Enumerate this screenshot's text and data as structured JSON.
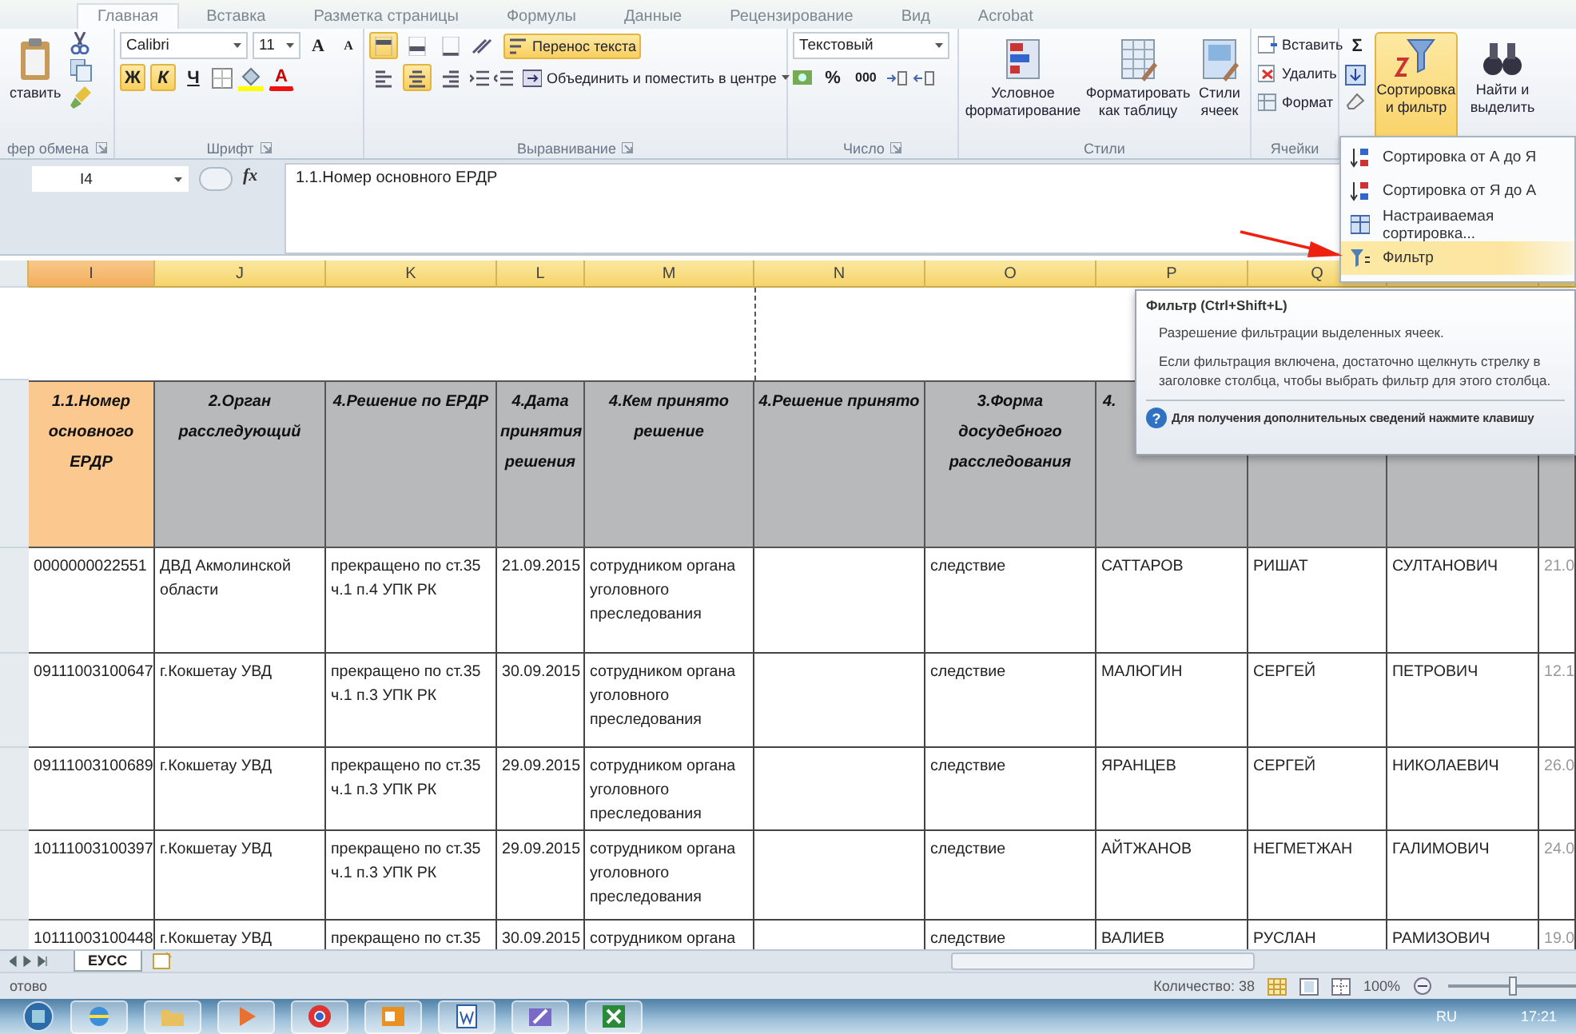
{
  "ribbon_tabs": [
    {
      "label": "Главная",
      "selected": true
    },
    {
      "label": "Вставка",
      "selected": false
    },
    {
      "label": "Разметка страницы",
      "selected": false
    },
    {
      "label": "Формулы",
      "selected": false
    },
    {
      "label": "Данные",
      "selected": false
    },
    {
      "label": "Рецензирование",
      "selected": false
    },
    {
      "label": "Вид",
      "selected": false
    },
    {
      "label": "Acrobat",
      "selected": false
    }
  ],
  "ribbon": {
    "clipboard": {
      "paste": "ставить",
      "label": "фер обмена"
    },
    "font": {
      "name": "Calibri",
      "size": "11",
      "grow": "A",
      "shrink": "A",
      "styles": [
        {
          "label": "Ж",
          "selected": true
        },
        {
          "label": "К",
          "selected": true
        },
        {
          "label": "Ч",
          "selected": false
        }
      ],
      "color_letter": "А",
      "label": "Шрифт"
    },
    "alignment": {
      "vertical_align": [
        {
          "selected": true
        },
        {
          "selected": false
        },
        {
          "selected": false
        }
      ],
      "horizontal_align": [
        {
          "selected": false
        },
        {
          "selected": true
        },
        {
          "selected": false
        }
      ],
      "wrap": {
        "label": "Перенос текста",
        "selected": true
      },
      "merge": "Объединить и поместить в центре",
      "label": "Выравнивание"
    },
    "number": {
      "format": "Текстовый",
      "percent": "%",
      "thousands": "000",
      "label": "Число"
    },
    "styles": {
      "buttons": [
        "Условное форматирование",
        "Форматировать как таблицу",
        "Стили ячеек"
      ],
      "label": "Стили"
    },
    "cells": {
      "buttons": [
        "Вставить",
        "Удалить",
        "Формат"
      ],
      "label": "Ячейки"
    },
    "editing": {
      "sum": "Σ",
      "buttons": [
        {
          "label": "Сортировка и фильтр",
          "selected": true
        },
        {
          "label": "Найти и выделить",
          "selected": false
        }
      ]
    }
  },
  "formula_bar": {
    "name_box": "I4",
    "fx": "fx",
    "content": "1.1.Номер основного ЕРДР"
  },
  "columns": [
    {
      "letter": "I",
      "selected": true
    },
    {
      "letter": "J",
      "selected": false
    },
    {
      "letter": "K",
      "selected": false
    },
    {
      "letter": "L",
      "selected": false
    },
    {
      "letter": "M",
      "selected": false
    },
    {
      "letter": "N",
      "selected": false
    },
    {
      "letter": "O",
      "selected": false
    },
    {
      "letter": "P",
      "selected": false
    },
    {
      "letter": "Q",
      "selected": false
    }
  ],
  "header_row": [
    {
      "text": "1.1.Номер основного ЕРДР",
      "selected": true
    },
    {
      "text": "2.Орган расследующий",
      "selected": false
    },
    {
      "text": "4.Решение по ЕРДР",
      "selected": false
    },
    {
      "text": "4.Дата принятия решения",
      "selected": false
    },
    {
      "text": "4.Кем принято решение",
      "selected": false
    },
    {
      "text": "4.Решение принято",
      "selected": false
    },
    {
      "text": "3.Форма досудебного расследования",
      "selected": false
    },
    {
      "text": "4.",
      "selected": false
    }
  ],
  "rows": [
    [
      "0000000022551",
      "ДВД Акмолинской области",
      "прекращено по ст.35 ч.1 п.4 УПК РК",
      "21.09.2015",
      "сотрудником органа уголовного преследования",
      null,
      "следствие",
      "САТТАРОВ",
      "РИШАТ",
      "СУЛТАНОВИЧ",
      "21.0"
    ],
    [
      "09111003100647",
      "г.Кокшетау УВД",
      "прекращено по ст.35 ч.1 п.3 УПК РК",
      "30.09.2015",
      "сотрудником органа уголовного преследования",
      null,
      "следствие",
      "МАЛЮГИН",
      "СЕРГЕЙ",
      "ПЕТРОВИЧ",
      "12.1"
    ],
    [
      "09111003100689",
      "г.Кокшетау УВД",
      "прекращено по ст.35 ч.1 п.3 УПК РК",
      "29.09.2015",
      "сотрудником органа уголовного преследования",
      null,
      "следствие",
      "ЯРАНЦЕВ",
      "СЕРГЕЙ",
      "НИКОЛАЕВИЧ",
      "26.0"
    ],
    [
      "10111003100397",
      "г.Кокшетау УВД",
      "прекращено по ст.35 ч.1 п.3 УПК РК",
      "29.09.2015",
      "сотрудником органа уголовного преследования",
      null,
      "следствие",
      "АЙТЖАНОВ",
      "НЕГМЕТЖАН",
      "ГАЛИМОВИЧ",
      "24.0"
    ],
    [
      "10111003100448",
      "г.Кокшетау УВД",
      "прекращено по ст.35",
      "30.09.2015",
      "сотрудником органа",
      null,
      "следствие",
      "ВАЛИЕВ",
      "РУСЛАН",
      "РАМИЗОВИЧ",
      "19.0"
    ]
  ],
  "sheet_tabs": [
    {
      "label": "ЕУСС",
      "selected": true
    }
  ],
  "status_bar": {
    "mode": "отово",
    "count": "Количество: 38",
    "zoom": "100%",
    "zoom_slider": {
      "level": 0.5
    }
  },
  "sort_menu": {
    "items": [
      {
        "label": "Сортировка от А до Я",
        "selected": false
      },
      {
        "label": "Сортировка от Я до А",
        "selected": false
      },
      {
        "label": "Настраиваемая сортировка...",
        "selected": false
      },
      {
        "label": "Фильтр",
        "selected": true
      }
    ]
  },
  "tooltip": {
    "title": "Фильтр (Ctrl+Shift+L)",
    "description": "Разрешение фильтрации выделенных ячеек.",
    "details": "Если фильтрация включена, достаточно щелкнуть стрелку в заголовке столбца, чтобы выбрать фильтр для этого столбца.",
    "help_icon": "?",
    "help": "Для получения дополнительных сведений нажмите клавишу"
  },
  "taskbar": {
    "language": "RU",
    "time": "17:21"
  }
}
